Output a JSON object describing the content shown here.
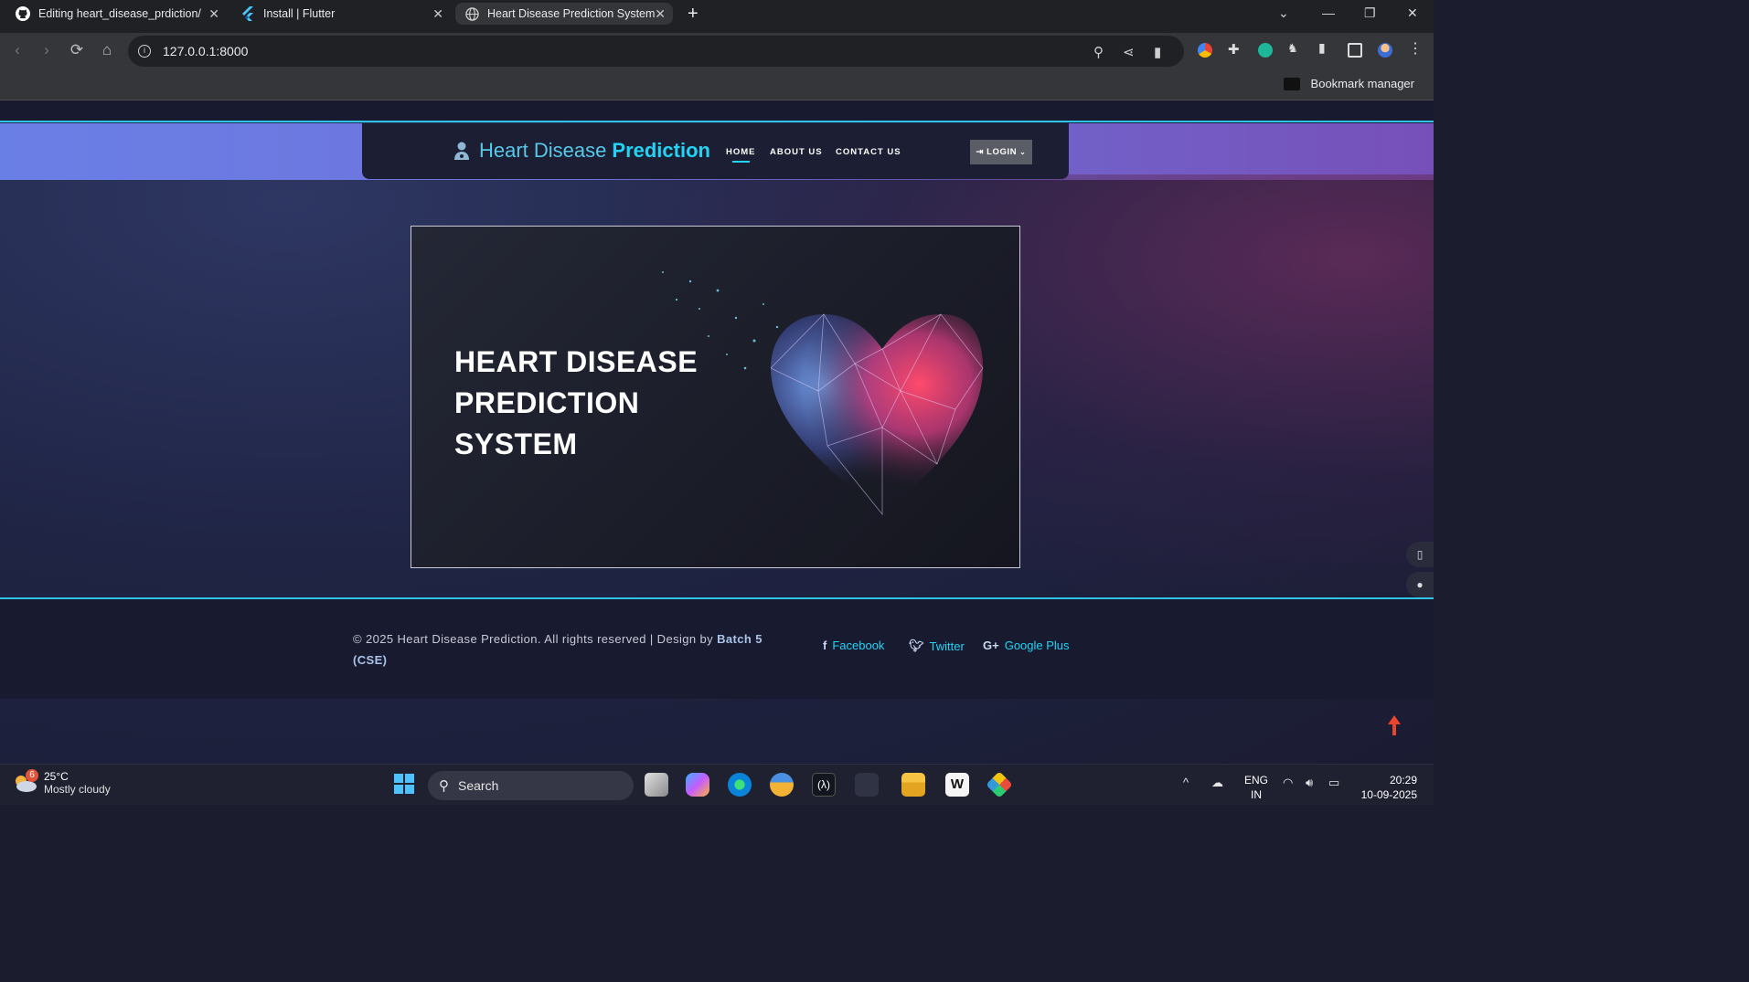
{
  "browser": {
    "tabs": [
      {
        "label": "Editing heart_disease_prdiction/",
        "icon": "github-icon"
      },
      {
        "label": "Install | Flutter",
        "icon": "flutter-icon"
      },
      {
        "label": "Heart Disease Prediction System",
        "icon": "globe-icon",
        "active": true
      }
    ],
    "url": "127.0.0.1:8000",
    "bookmark_manager": "Bookmark manager"
  },
  "site": {
    "brand_light": "Heart Disease",
    "brand_bold": "Prediction",
    "nav": [
      "HOME",
      "ABOUT US",
      "CONTACT US"
    ],
    "active_nav": "HOME",
    "login": "LOGIN",
    "hero_title_lines": [
      "HEART DISEASE",
      "PREDICTION",
      "SYSTEM"
    ],
    "footer": {
      "copyright": "© 2025 Heart Disease Prediction. All rights reserved | Design by",
      "designer": "Batch 5 (CSE)",
      "social": [
        "Facebook",
        "Twitter",
        "Google Plus"
      ]
    }
  },
  "colors": {
    "accent": "#21d4f5",
    "header_gradient_start": "#6a7fe6",
    "header_gradient_end": "#7650b8"
  },
  "taskbar": {
    "weather_temp": "25°C",
    "weather_desc": "Mostly cloudy",
    "weather_badge": "6",
    "search_label": "Search",
    "lang_1": "ENG",
    "lang_2": "IN",
    "time": "20:29",
    "date": "10-09-2025"
  }
}
